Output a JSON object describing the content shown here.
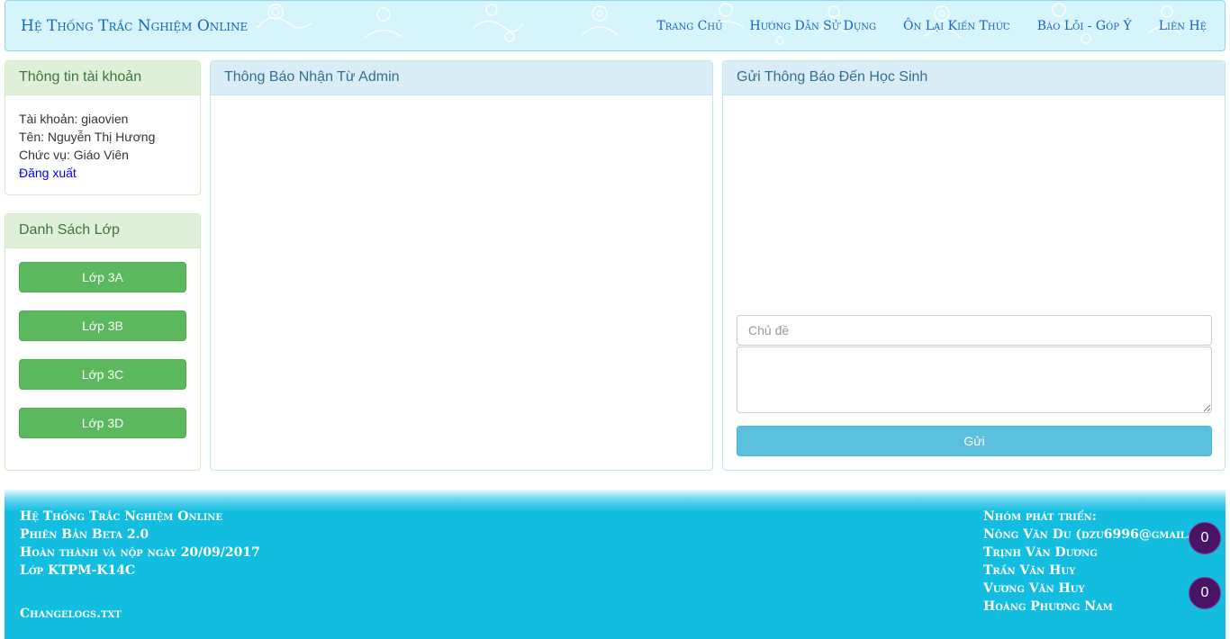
{
  "header": {
    "brand": "Hệ Thống Trắc Nghiệm Online",
    "nav": [
      "Trang Chủ",
      "Hướng Dẫn Sử Dụng",
      "Ôn Lại Kiến Thức",
      "Báo Lỗi - Góp Ý",
      "Liên Hệ"
    ]
  },
  "account": {
    "title": "Thông tin tài khoản",
    "username": "Tài khoản: giaovien",
    "name": "Tên: Nguyễn Thị Hương",
    "role": "Chức vụ: Giáo Viên",
    "logout": "Đăng xuất"
  },
  "classes": {
    "title": "Danh Sách Lớp",
    "items": [
      "Lớp 3A",
      "Lớp 3B",
      "Lớp 3C",
      "Lớp 3D"
    ]
  },
  "admin_panel": {
    "title": "Thông Báo Nhận Từ Admin"
  },
  "send_panel": {
    "title": "Gửi Thông Báo Đến Học Sinh",
    "subject_placeholder": "Chủ đề",
    "subject_value": "",
    "message_value": "",
    "button": "Gửi"
  },
  "footer": {
    "left": [
      "Hệ Thống Trắc Nghiệm Online",
      "Phiên Bản Beta 2.0",
      "Hoàn thành và nộp ngày 20/09/2017",
      "Lớp KTPM-K14C"
    ],
    "changelog": "Changelogs.txt",
    "right_title": "Nhóm phát triển:",
    "members": [
      "Nông Văn Du (dzu6996@gmail.com)",
      "Trịnh Văn Dương",
      "Trần Văn Huy",
      "Vương Văn Huy",
      "Hoàng Phương Nam"
    ]
  },
  "badges": [
    "0",
    "0"
  ],
  "colors": {
    "header_bg": "#d6f4fb",
    "footer_bg": "#13bde0",
    "success": "#5cb85c",
    "info": "#5bc0de",
    "badge": "#4a1466"
  }
}
